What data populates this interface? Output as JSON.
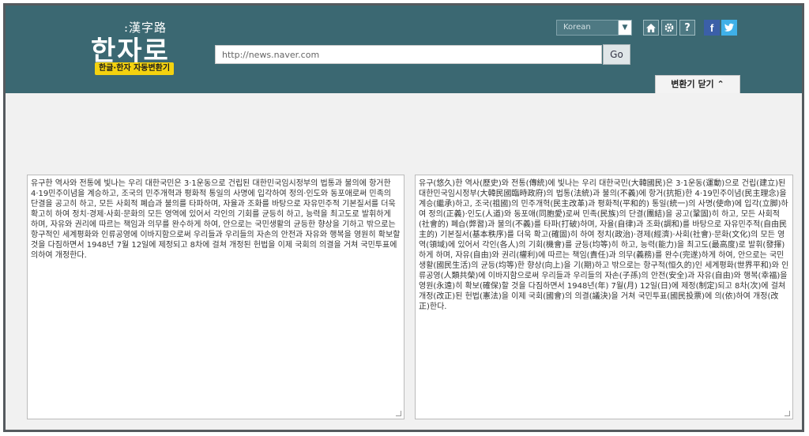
{
  "header": {
    "logo_sub": ":漢字路",
    "logo_main": "한자로",
    "logo_badge": "한글·한자 자동변환기",
    "language": "Korean",
    "url_value": "http://news.naver.com",
    "go_label": "Go",
    "home_icon": "home-icon",
    "settings_icon": "gear-icon",
    "help_label": "?",
    "facebook_label": "f",
    "twitter_icon": "twitter-bird-icon",
    "close_tab_label": "변환기 닫기 ⌃"
  },
  "colors": {
    "header_bg": "#3b6872",
    "badge_bg": "#f4d20f",
    "facebook": "#3b5fa8",
    "twitter": "#3fb0e8"
  },
  "panels": {
    "input_text": "유구한 역사와 전통에 빛나는 우리 대한국민은 3·1운동으로 건립된 대한민국임시정부의 법통과 불의에 항거한 4·19민주이념을 계승하고, 조국의 민주개혁과 평화적 통일의 사명에 입각하여 정의·인도와 동포애로써 민족의 단결을 공고히 하고, 모든 사회적 폐습과 불의를 타파하며, 자율과 조화를 바탕으로 자유민주적 기본질서를 더욱 확고히 하여 정치·경제·사회·문화의 모든 영역에 있어서 각인의 기회를 균등히 하고, 능력을 최고도로 발휘하게 하며, 자유와 권리에 따르는 책임과 의무를 완수하게 하여, 안으로는 국민생활의 균등한 향상을 기하고 밖으로는 항구적인 세계평화와 인류공영에 이바지함으로써 우리들과 우리들의 자손의 안전과 자유와 행복을 영원히 확보할 것을 다짐하면서 1948년 7월 12일에 제정되고 8차에 걸쳐 개정된 헌법을 이제 국회의 의결을 거쳐 국민투표에 의하여 개정한다.",
    "output_text": "유구(悠久)한 역사(歷史)와 전통(傳統)에 빛나는 우리 대한국민(大韓國民)은 3·1운동(運動)으로 건립(建立)된 대한민국임시정부(大韓民國臨時政府)의 법통(法統)과 불의(不義)에 항거(抗拒)한 4·19민주이념(民主理念)을 계승(繼承)하고, 조국(祖國)의 민주개혁(民主改革)과 평화적(平和的) 통일(統一)의 사명(使命)에 입각(立脚)하여 정의(正義)·인도(人道)와 동포애(同胞愛)로써 민족(民族)의 단결(團結)을 공고(鞏固)히 하고, 모든 사회적(社會的) 폐습(弊習)과 불의(不義)를 타파(打破)하며, 자율(自律)과 조화(調和)를 바탕으로 자유민주적(自由民主的) 기본질서(基本秩序)를 더욱 확고(確固)히 하여 정치(政治)·경제(經濟)·사회(社會)·문화(文化)의 모든 영역(領域)에 있어서 각인(各人)의 기회(機會)를 균등(均等)히 하고, 능력(能力)을 최고도(最高度)로 발휘(發揮)하게 하며, 자유(自由)와 권리(權利)에 따르는 책임(責任)과 의무(義務)를 완수(完遂)하게 하여, 안으로는 국민생활(國民生活)의 균등(均等)한 향상(向上)을 기(期)하고 밖으로는 항구적(恒久的)인 세계평화(世界平和)와 인류공영(人類共榮)에 이바지함으로써 우리들과 우리들의 자손(子孫)의 안전(安全)과 자유(自由)와 행복(幸福)을 영원(永遠)히 확보(確保)할 것을 다짐하면서 1948년(年) 7월(月) 12일(日)에 제정(制定)되고 8차(次)에 걸쳐 개정(改正)된 헌법(憲法)을 이제 국회(國會)의 의결(議決)을 거쳐 국민투표(國民投票)에 의(依)하여 개정(改正)한다."
  }
}
